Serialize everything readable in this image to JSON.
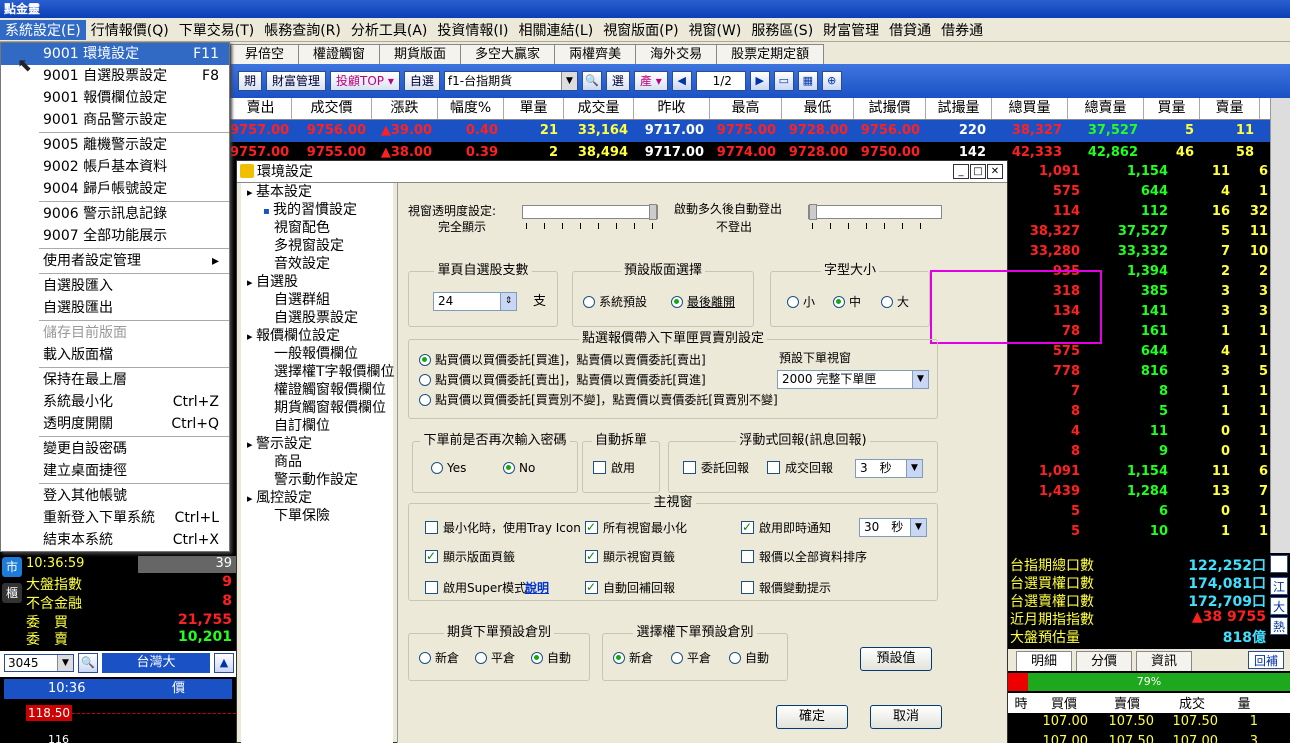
{
  "app": {
    "title": "點金靈"
  },
  "menubar": [
    "系統設定(E)",
    "行情報價(Q)",
    "下單交易(T)",
    "帳務查詢(R)",
    "分析工具(A)",
    "投資情報(I)",
    "相關連結(L)",
    "視窗版面(P)",
    "視窗(W)",
    "服務區(S)",
    "財富管理",
    "借貸通",
    "借券通"
  ],
  "tabs": [
    "昇倍空",
    "權證觸窗",
    "期貨版面",
    "多空大贏家",
    "兩權齊美",
    "海外交易",
    "股票定期定額"
  ],
  "toolbar": {
    "b1": "期",
    "b2": "財富管理",
    "b3": "投顧TOP",
    "b4": "自選",
    "symbol": "f1-台指期貨",
    "b5": "選",
    "b6": "產",
    "page": "1/2"
  },
  "quote": {
    "headers": [
      "賣出",
      "成交價",
      "漲跌",
      "幅度%",
      "單量",
      "成交量",
      "昨收",
      "最高",
      "最低",
      "試撮價",
      "試撮量",
      "總買量",
      "總賣量",
      "買量",
      "賣量"
    ],
    "rows": [
      [
        "9757.00",
        "9756.00",
        "▲39.00",
        "0.40",
        "21",
        "33,164",
        "9717.00",
        "9775.00",
        "9728.00",
        "9756.00",
        "220",
        "38,327",
        "37,527",
        "5",
        "11"
      ],
      [
        "9757.00",
        "9755.00",
        "▲38.00",
        "0.39",
        "2",
        "38,494",
        "9717.00",
        "9774.00",
        "9728.00",
        "9750.00",
        "142",
        "42,333",
        "42,862",
        "46",
        "58"
      ]
    ]
  },
  "rightcol": [
    [
      "1,091",
      "1,154",
      "11",
      "6"
    ],
    [
      "575",
      "644",
      "4",
      "1"
    ],
    [
      "114",
      "112",
      "16",
      "32"
    ],
    [
      "38,327",
      "37,527",
      "5",
      "11"
    ],
    [
      "33,280",
      "33,332",
      "7",
      "10"
    ],
    [
      "935",
      "1,394",
      "2",
      "2"
    ],
    [
      "318",
      "385",
      "3",
      "3"
    ],
    [
      "134",
      "141",
      "3",
      "3"
    ],
    [
      "78",
      "161",
      "1",
      "1"
    ],
    [
      "575",
      "644",
      "4",
      "1"
    ],
    [
      "778",
      "816",
      "3",
      "5"
    ],
    [
      "7",
      "8",
      "1",
      "1"
    ],
    [
      "8",
      "5",
      "1",
      "1"
    ],
    [
      "4",
      "11",
      "0",
      "1"
    ],
    [
      "8",
      "9",
      "0",
      "1"
    ],
    [
      "1,091",
      "1,154",
      "11",
      "6"
    ],
    [
      "1,439",
      "1,284",
      "13",
      "7"
    ],
    [
      "5",
      "6",
      "0",
      "1"
    ],
    [
      "5",
      "10",
      "1",
      "1"
    ]
  ],
  "menu": {
    "items": [
      {
        "label": "9001 環境設定",
        "sc": "F11",
        "hl": true
      },
      {
        "label": "9001 自選股票設定",
        "sc": "F8"
      },
      {
        "label": "9001 報價欄位設定"
      },
      {
        "label": "9001 商品警示設定"
      },
      {
        "label": "9005 離機警示設定"
      },
      {
        "label": "9002 帳戶基本資料"
      },
      {
        "label": "9004 歸戶帳號設定"
      },
      {
        "label": "9006 警示訊息記錄"
      },
      {
        "label": "9007 全部功能展示"
      },
      {
        "label": "使用者設定管理",
        "sc": "▸"
      },
      {
        "label": "自選股匯入"
      },
      {
        "label": "自選股匯出"
      },
      {
        "label": "儲存目前版面",
        "dis": true
      },
      {
        "label": "載入版面檔"
      },
      {
        "label": "保持在最上層"
      },
      {
        "label": "系統最小化",
        "sc": "Ctrl+Z"
      },
      {
        "label": "透明度開關",
        "sc": "Ctrl+Q"
      },
      {
        "label": "變更自設密碼"
      },
      {
        "label": "建立桌面捷徑"
      },
      {
        "label": "登入其他帳號"
      },
      {
        "label": "重新登入下單系統",
        "sc": "Ctrl+L"
      },
      {
        "label": "結束本系統",
        "sc": "Ctrl+X"
      }
    ]
  },
  "bottomleft": {
    "time": "10:36:59",
    "time_val": "39",
    "l1": "大盤指數",
    "v1": "9",
    "l2": "不含金融",
    "v2": "8",
    "l3": "委　買",
    "v3": "21,755",
    "l4": "委　賣",
    "v4": "10,201",
    "code": "3045",
    "name": "台灣大",
    "col1": "10:36",
    "col2": "價",
    "price": "118.50",
    "price2": "116",
    "side1": "市",
    "side2": "櫃"
  },
  "bottomright": {
    "labels": [
      "台指期總口數",
      "台選買權口數",
      "台選賣權口數",
      "近月期指指數",
      "大盤預估量"
    ],
    "values": [
      "122,252口",
      "174,081口",
      "172,709口",
      "▲38 9755",
      "818億"
    ],
    "side": [
      "江",
      "大",
      "熱"
    ],
    "tabs": [
      "明細",
      "分價",
      "資訊"
    ],
    "reply": "回補",
    "pct": "79%",
    "hdr": [
      "時",
      "買價",
      "賣價",
      "成交",
      "量"
    ],
    "rows": [
      [
        "107.00",
        "107.50",
        "107.50",
        "1"
      ],
      [
        "107.00",
        "107.50",
        "107.00",
        "3"
      ]
    ]
  },
  "dialog": {
    "title": "環境設定",
    "tree": [
      {
        "t": "基本設定",
        "lv": 0
      },
      {
        "t": "我的習慣設定",
        "lv": 1,
        "sel": true
      },
      {
        "t": "視窗配色",
        "lv": 1
      },
      {
        "t": "多視窗設定",
        "lv": 1
      },
      {
        "t": "音效設定",
        "lv": 1
      },
      {
        "t": "自選股",
        "lv": 0
      },
      {
        "t": "自選群組",
        "lv": 1
      },
      {
        "t": "自選股票設定",
        "lv": 1
      },
      {
        "t": "報價欄位設定",
        "lv": 0
      },
      {
        "t": "一般報價欄位",
        "lv": 1
      },
      {
        "t": "選擇權T字報價欄位",
        "lv": 1
      },
      {
        "t": "權證觸窗報價欄位",
        "lv": 1
      },
      {
        "t": "期貨觸窗報價欄位",
        "lv": 1
      },
      {
        "t": "自訂欄位",
        "lv": 1
      },
      {
        "t": "警示設定",
        "lv": 0
      },
      {
        "t": "商品",
        "lv": 1
      },
      {
        "t": "警示動作設定",
        "lv": 1
      },
      {
        "t": "風控設定",
        "lv": 0
      },
      {
        "t": "下單保險",
        "lv": 1
      }
    ],
    "transp_label": "視窗透明度設定:",
    "transp_val": "完全顯示",
    "auto_label": "啟動多久後自動登出",
    "auto_val": "不登出",
    "page_grp": "單頁自選股支數",
    "page_val": "24",
    "page_unit": "支",
    "layout_grp": "預設版面選擇",
    "layout_opts": [
      "系統預設",
      "最後離開"
    ],
    "font_grp": "字型大小",
    "font_opts": [
      "小",
      "中",
      "大"
    ],
    "click_grp": "點選報價帶入下單匣買賣別設定",
    "click_opts": [
      "點買價以買價委託[買進]，點賣價以賣價委託[賣出]",
      "點買價以買價委託[賣出]，點賣價以賣價委託[買進]",
      "點買價以買價委託[買賣別不變]，點賣價以賣價委託[買賣別不變]"
    ],
    "order_win_label": "預設下單視窗",
    "order_win_val": "2000 完整下單匣",
    "pwd_grp": "下單前是否再次輸入密碼",
    "pwd_opts": [
      "Yes",
      "No"
    ],
    "split_grp": "自動拆單",
    "split_opt": "啟用",
    "float_grp": "浮動式回報(訊息回報)",
    "float_opts": [
      "委託回報",
      "成交回報"
    ],
    "float_sec": "3　秒",
    "main_grp": "主視窗",
    "main_opts": [
      "最小化時，使用Tray Icon",
      "所有視窗最小化",
      "啟用即時通知",
      "顯示版面頁籤",
      "顯示視窗頁籤",
      "報價以全部資料排序",
      "啟用Super模式",
      "自動回補回報",
      "報價變動提示"
    ],
    "notify_sec": "30　秒",
    "explain": "說明",
    "fut_grp": "期貨下單預設倉別",
    "fut_opts": [
      "新倉",
      "平倉",
      "自動"
    ],
    "opt_grp": "選擇權下單預設倉別",
    "opt_opts": [
      "新倉",
      "平倉",
      "自動"
    ],
    "default_btn": "預設值",
    "ok_btn": "確定",
    "cancel_btn": "取消"
  }
}
